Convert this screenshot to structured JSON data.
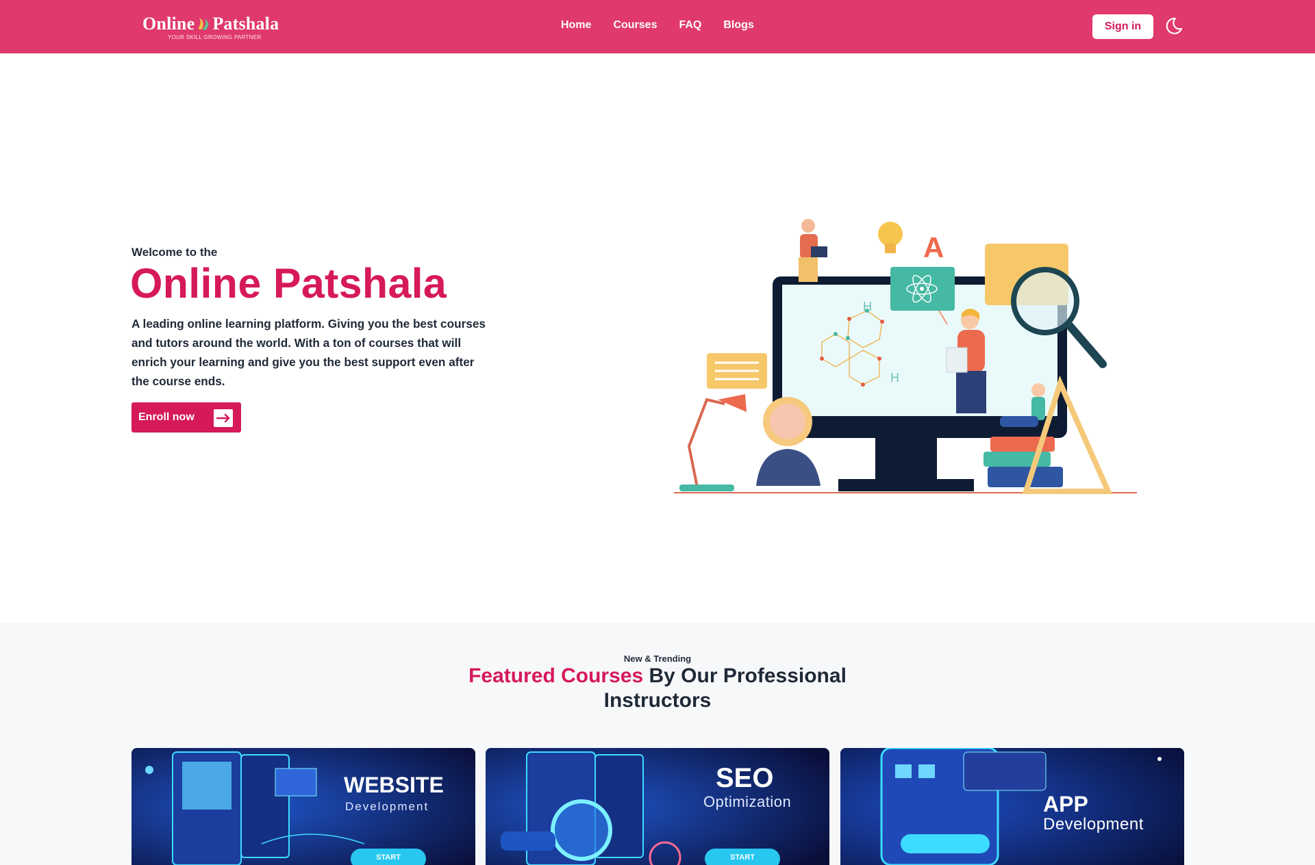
{
  "colors": {
    "brand": "#e0396e",
    "accent": "#d6195b",
    "text": "#1f2937",
    "section_bg": "#f7f8fa"
  },
  "navbar": {
    "logo_text_light": "Online",
    "logo_text_dark": "Patshala",
    "logo_tagline": "YOUR SKILL GROWING PARTNER",
    "links": [
      "Home",
      "Courses",
      "FAQ",
      "Blogs"
    ],
    "signin_label": "Sign in",
    "theme_icon": "moon-icon"
  },
  "hero": {
    "welcome": "Welcome to the",
    "title": "Online Patshala",
    "description": "A leading online learning platform. Giving you the best courses and tutors around the world. With a ton of courses that will enrich your learning and give you the best support even after the course ends.",
    "cta_label": "Enroll now",
    "cta_icon": "arrow-right-icon",
    "illustration": "online-learning-illustration"
  },
  "featured": {
    "eyebrow": "New & Trending",
    "title_accent": "Featured Courses",
    "title_rest": " By Our Professional Instructors",
    "cards": [
      {
        "title": "WEBSITE",
        "subtitle": "Development",
        "start": "START"
      },
      {
        "title": "SEO",
        "subtitle": "Optimization",
        "start": "START"
      },
      {
        "title": "APP",
        "subtitle": "Development",
        "start": ""
      }
    ]
  }
}
